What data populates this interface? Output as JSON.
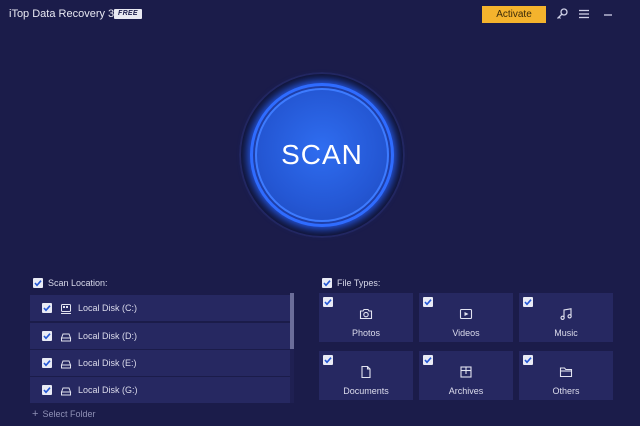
{
  "app": {
    "title": "iTop Data Recovery 3.0",
    "badge": "FREE"
  },
  "header": {
    "activate_label": "Activate"
  },
  "scan": {
    "label": "SCAN"
  },
  "scan_location": {
    "label": "Scan Location:",
    "items": [
      {
        "label": "Local Disk (C:)",
        "icon": "system-disk-icon"
      },
      {
        "label": "Local Disk (D:)",
        "icon": "disk-icon"
      },
      {
        "label": "Local Disk (E:)",
        "icon": "disk-icon"
      },
      {
        "label": "Local Disk (G:)",
        "icon": "disk-icon"
      }
    ],
    "select_folder": "Select Folder"
  },
  "file_types": {
    "label": "File Types:",
    "items": [
      {
        "label": "Photos",
        "icon": "camera-icon"
      },
      {
        "label": "Videos",
        "icon": "video-icon"
      },
      {
        "label": "Music",
        "icon": "music-icon"
      },
      {
        "label": "Documents",
        "icon": "document-icon"
      },
      {
        "label": "Archives",
        "icon": "archive-icon"
      },
      {
        "label": "Others",
        "icon": "folder-icon"
      }
    ]
  },
  "colors": {
    "background": "#1b1c4a",
    "panel": "#262861",
    "accent": "#2457d4",
    "activate": "#f4b32d"
  }
}
